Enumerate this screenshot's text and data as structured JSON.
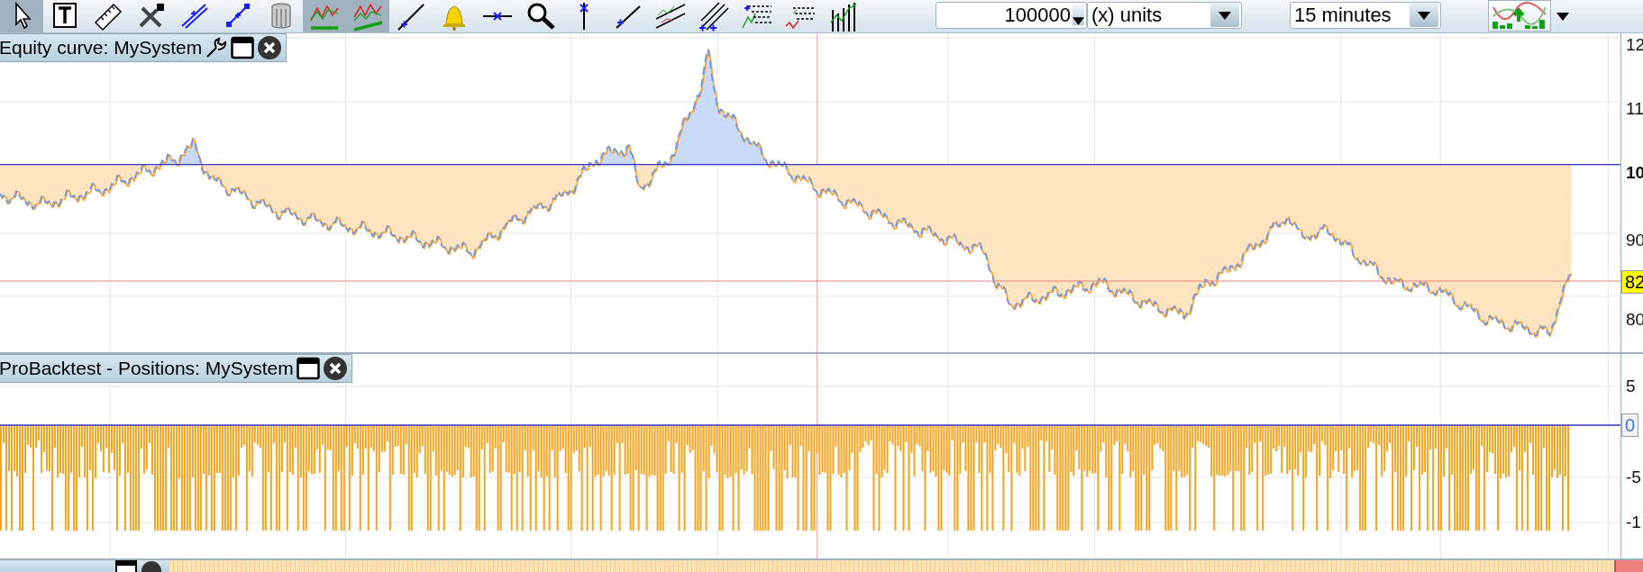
{
  "toolbar": {
    "tools": [
      {
        "kind": "pointer",
        "selected": true
      },
      {
        "kind": "text",
        "selected": false
      },
      {
        "kind": "ruler",
        "selected": false
      },
      {
        "kind": "tools",
        "selected": false
      },
      {
        "kind": "channel",
        "selected": false
      },
      {
        "kind": "segment-point",
        "selected": false
      },
      {
        "kind": "trash",
        "selected": false
      },
      {
        "kind": "trend",
        "selected": true
      },
      {
        "kind": "trend-bold",
        "selected": true
      },
      {
        "kind": "segment",
        "selected": false
      },
      {
        "kind": "alert",
        "selected": false
      },
      {
        "kind": "hline",
        "selected": false
      },
      {
        "kind": "zoom",
        "selected": false
      },
      {
        "kind": "vline",
        "selected": false
      },
      {
        "kind": "ray",
        "selected": false
      },
      {
        "kind": "channel-lines",
        "selected": false
      },
      {
        "kind": "fan",
        "selected": false
      },
      {
        "kind": "fib",
        "selected": false
      },
      {
        "kind": "fib-red",
        "selected": false
      },
      {
        "kind": "bars",
        "selected": false
      }
    ],
    "quantity": {
      "value": "100000"
    },
    "units": {
      "value": "(x) units"
    },
    "timeframe": {
      "value": "15 minutes"
    }
  },
  "equity_panel": {
    "title": "Equity curve: MySystem",
    "axis_labels": [
      {
        "text": "12",
        "kind": "tick"
      },
      {
        "text": "11",
        "kind": "tick"
      },
      {
        "text": "10",
        "kind": "reference"
      },
      {
        "text": "90",
        "kind": "tick"
      },
      {
        "text": "80",
        "kind": "tick"
      }
    ],
    "current_value": "82"
  },
  "positions_panel": {
    "title": "ProBacktest - Positions: MySystem",
    "axis_labels": [
      {
        "text": "5"
      },
      {
        "text": "-5"
      },
      {
        "text": "-1"
      }
    ],
    "zero_label": "0"
  }
}
